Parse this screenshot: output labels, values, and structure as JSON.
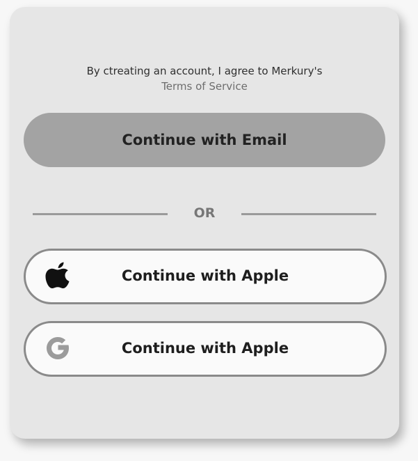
{
  "terms": {
    "text": "By ctreating an account, I agree to Merkury's",
    "link_label": "Terms of Service"
  },
  "buttons": {
    "email_label": "Continue with Email",
    "apple_label": "Continue with Apple",
    "google_label": "Continue with Apple"
  },
  "divider": {
    "label": "OR"
  },
  "icons": {
    "apple": "apple-icon",
    "google": "google-icon"
  },
  "colors": {
    "card_bg": "#e6e6e6",
    "email_button_bg": "#a3a3a3",
    "social_button_border": "#8a8a8a",
    "social_button_bg": "#fafafa"
  }
}
